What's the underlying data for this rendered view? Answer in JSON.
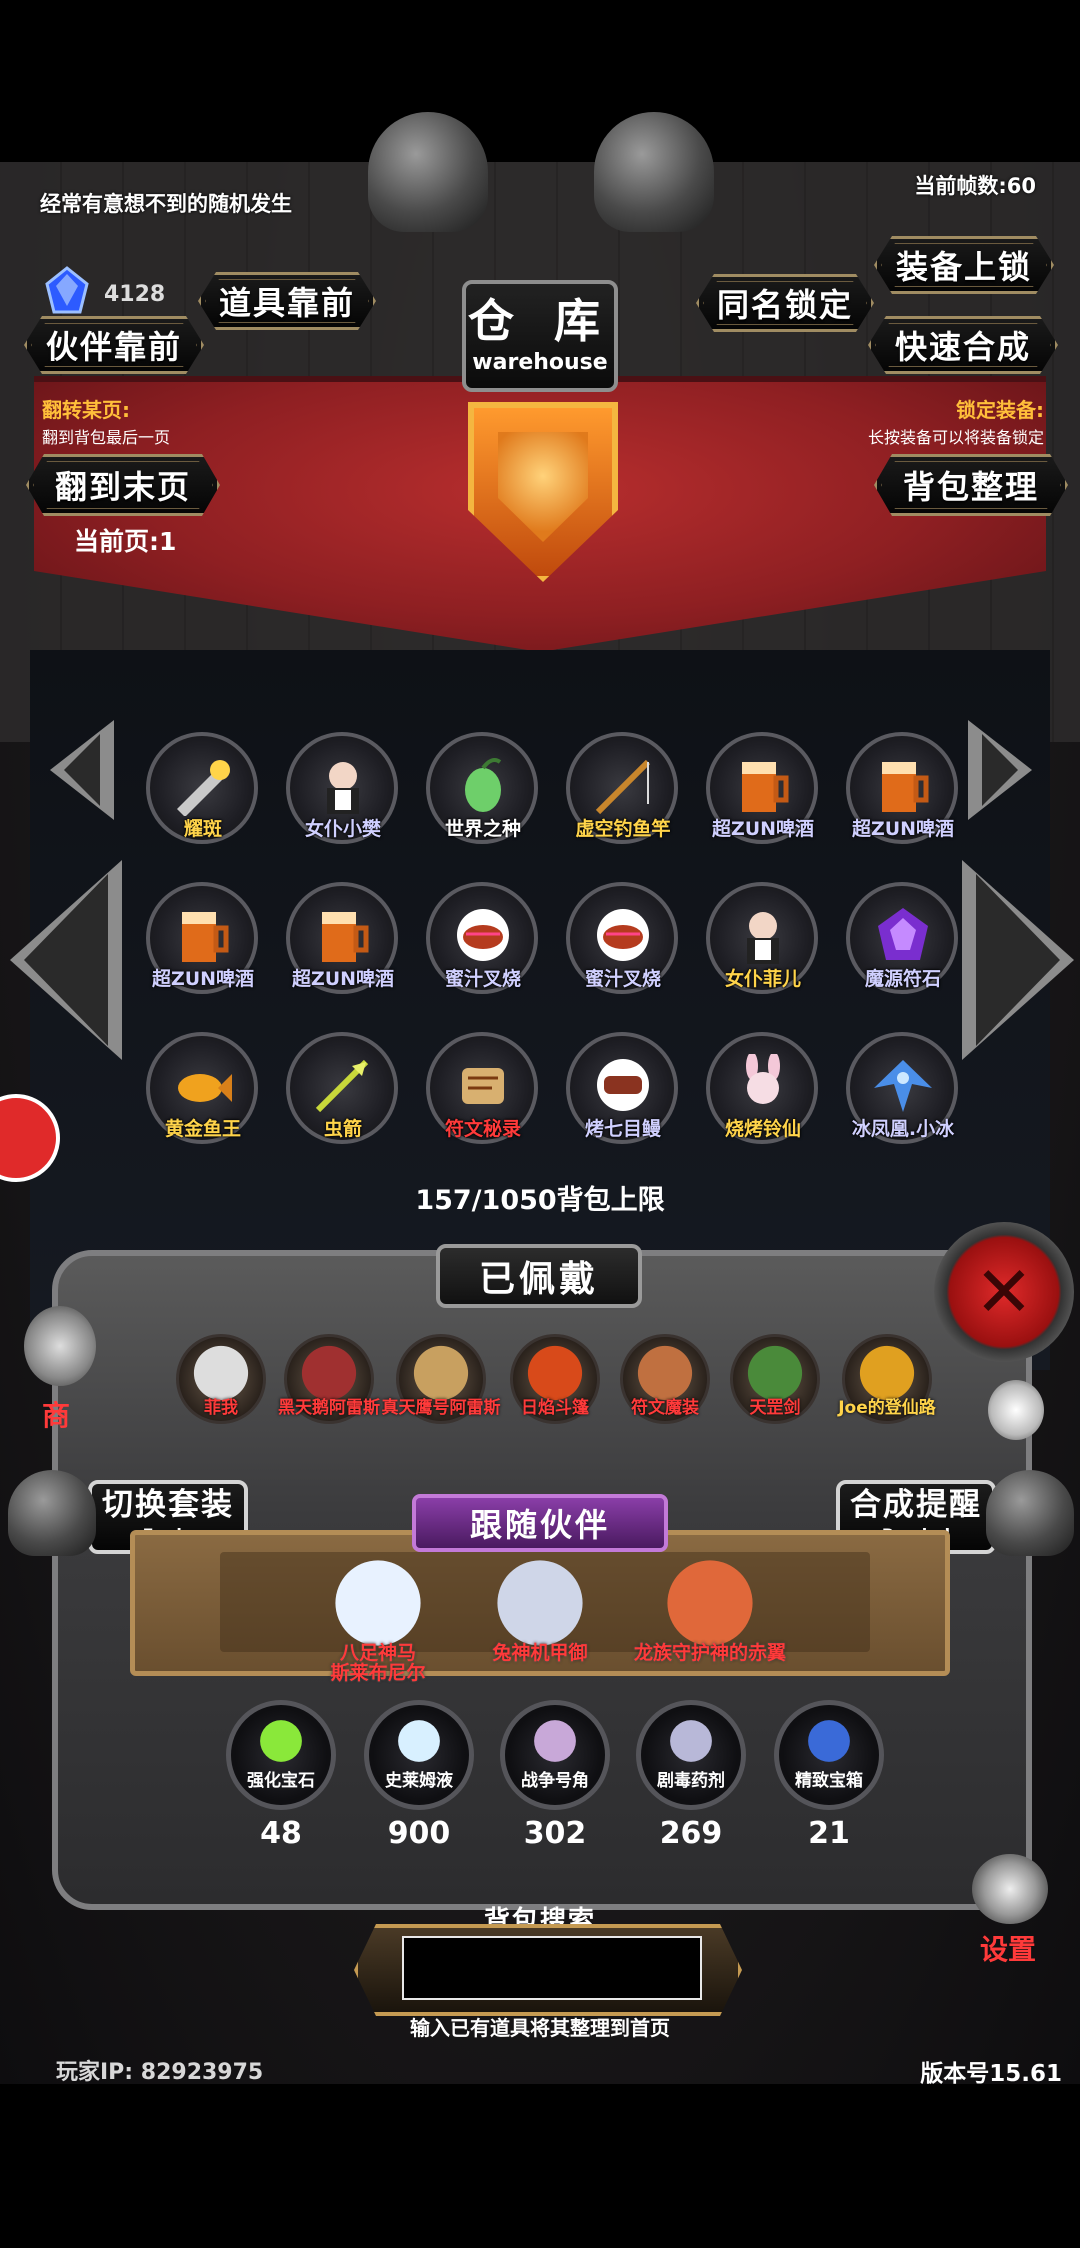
{
  "header": {
    "tagline": "经常有意想不到的随机发生",
    "fps": "当前帧数:60",
    "gem_count": "4128"
  },
  "title": {
    "cn": "仓 库",
    "en": "warehouse"
  },
  "buttons": {
    "items_front": "道具靠前",
    "partner_front": "伙伴靠前",
    "same_name_lock": "同名锁定",
    "equip_lock": "装备上锁",
    "quick_merge": "快速合成",
    "to_last_page": "翻到末页",
    "bag_sort": "背包整理"
  },
  "info": {
    "flip_label": "翻转某页:",
    "flip_desc": "翻到背包最后一页",
    "lock_label": "锁定装备:",
    "lock_desc": "长按装备可以将装备锁定",
    "current_page": "当前页:1"
  },
  "warehouse_items": [
    {
      "name": "耀斑",
      "color": "#ffd44a",
      "icon": "weapon-icon"
    },
    {
      "name": "女仆小樊",
      "color": "#d0d0ff",
      "icon": "maid-icon"
    },
    {
      "name": "世界之种",
      "color": "#ffffff",
      "icon": "seed-icon"
    },
    {
      "name": "虚空钓鱼竿",
      "color": "#ffd44a",
      "icon": "fishing-rod-icon"
    },
    {
      "name": "超ZUN啤酒",
      "color": "#d0d0ff",
      "icon": "beer-icon"
    },
    {
      "name": "超ZUN啤酒",
      "color": "#d0d0ff",
      "icon": "beer-icon"
    },
    {
      "name": "超ZUN啤酒",
      "color": "#d0d0ff",
      "icon": "beer-icon"
    },
    {
      "name": "超ZUN啤酒",
      "color": "#d0d0ff",
      "icon": "beer-icon"
    },
    {
      "name": "蜜汁叉烧",
      "color": "#d0d0ff",
      "icon": "meat-icon"
    },
    {
      "name": "蜜汁叉烧",
      "color": "#d0d0ff",
      "icon": "meat-icon"
    },
    {
      "name": "女仆菲儿",
      "color": "#ffd44a",
      "icon": "maid-icon"
    },
    {
      "name": "魔源符石",
      "color": "#d0d0ff",
      "icon": "rune-stone-icon"
    },
    {
      "name": "黄金鱼王",
      "color": "#ffd44a",
      "icon": "golden-fish-icon"
    },
    {
      "name": "虫箭",
      "color": "#ffd44a",
      "icon": "arrow-icon"
    },
    {
      "name": "符文秘录",
      "color": "#ff3a3a",
      "icon": "scroll-icon"
    },
    {
      "name": "烤七目鳗",
      "color": "#d0d0ff",
      "icon": "grilled-eel-icon"
    },
    {
      "name": "烧烤铃仙",
      "color": "#ffd44a",
      "icon": "bunny-girl-icon"
    },
    {
      "name": "冰凤凰.小冰",
      "color": "#d0d0ff",
      "icon": "ice-phoenix-icon"
    }
  ],
  "capacity": "157/1050背包上限",
  "equipped": {
    "title": "已佩戴",
    "items": [
      {
        "name": "菲我",
        "icon": "mask-icon"
      },
      {
        "name": "黑天鹅阿雷斯",
        "icon": "dark-armor-icon"
      },
      {
        "name": "真天鹰号阿雷斯",
        "icon": "winged-armor-icon"
      },
      {
        "name": "日焰斗篷",
        "icon": "flame-cloak-icon"
      },
      {
        "name": "符文魔装",
        "icon": "rune-armor-icon"
      },
      {
        "name": "天罡剑",
        "icon": "sword-icon"
      },
      {
        "name": "Joe的登仙路",
        "icon": "book-icon"
      }
    ]
  },
  "switch_outfit": {
    "cn": "切换套装",
    "en": "Equip"
  },
  "merge_remind": {
    "cn": "合成提醒",
    "en": "Remind"
  },
  "follow": {
    "title": "跟随伙伴",
    "pets": [
      {
        "name": "八足神马\n斯莱布尼尔",
        "icon": "pegasus-icon"
      },
      {
        "name": "兔神机甲御",
        "icon": "mecha-rabbit-icon"
      },
      {
        "name": "龙族守护神的赤翼",
        "icon": "red-dragon-icon"
      }
    ]
  },
  "materials": [
    {
      "name": "强化宝石",
      "count": "48",
      "icon": "green-gem-icon"
    },
    {
      "name": "史莱姆液",
      "count": "900",
      "icon": "potion-icon"
    },
    {
      "name": "战争号角",
      "count": "302",
      "icon": "horn-icon"
    },
    {
      "name": "剧毒药剂",
      "count": "269",
      "icon": "poison-icon"
    },
    {
      "name": "精致宝箱",
      "count": "21",
      "icon": "chest-icon"
    }
  ],
  "search": {
    "title": "背包搜索",
    "value": "",
    "hint": "输入已有道具将其整理到首页"
  },
  "footer": {
    "player_ip": "玩家IP:  82923975",
    "version": "版本号15.61"
  },
  "side": {
    "shop": "商",
    "settings": "设置"
  }
}
